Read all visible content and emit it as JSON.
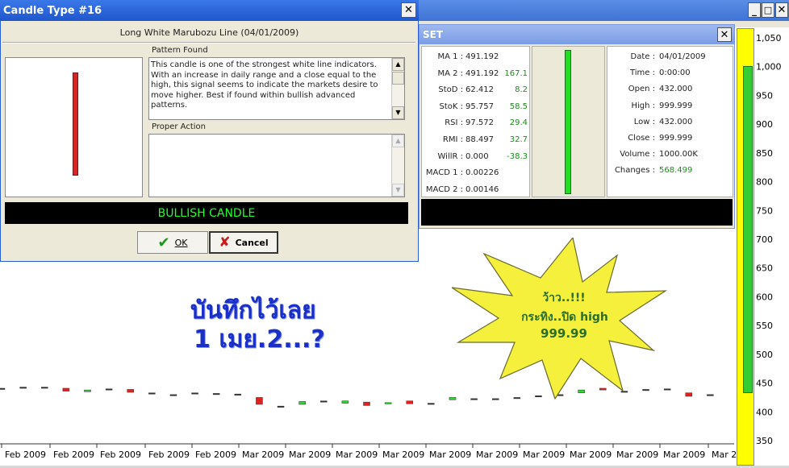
{
  "candle_dialog": {
    "title": "Candle Type #16",
    "subtitle": "Long White Marubozu Line (04/01/2009)",
    "pattern_found_label": "Pattern Found",
    "pattern_text": "This candle is one of the strongest white line indicators. With an increase in daily range and a close equal to the high, this signal seems to indicate the markets desire to move higher. Best if found within bullish advanced patterns.",
    "proper_action_label": "Proper Action",
    "proper_action_text": "",
    "signal": "BULLISH CANDLE",
    "ok_label": "OK",
    "cancel_label": "Cancel"
  },
  "set_panel": {
    "title": "SET",
    "indicators": [
      {
        "label": "MA 1 :",
        "value": "491.192",
        "extra": ""
      },
      {
        "label": "MA 2 :",
        "value": "491.192",
        "extra": "167.1"
      },
      {
        "label": "StoD :",
        "value": "62.412",
        "extra": "8.2"
      },
      {
        "label": "StoK :",
        "value": "95.757",
        "extra": "58.5"
      },
      {
        "label": "RSI :",
        "value": "97.572",
        "extra": "29.4"
      },
      {
        "label": "RMI :",
        "value": "88.497",
        "extra": "32.7"
      },
      {
        "label": "WillR :",
        "value": "0.000",
        "extra": "-38.3"
      },
      {
        "label": "MACD 1 :",
        "value": "0.00226",
        "extra": ""
      },
      {
        "label": "MACD 2 :",
        "value": "0.00146",
        "extra": ""
      }
    ],
    "quote": [
      {
        "label": "Date :",
        "value": "04/01/2009"
      },
      {
        "label": "Time :",
        "value": "0:00:00"
      },
      {
        "label": "Open :",
        "value": "432.000"
      },
      {
        "label": "High :",
        "value": "999.999"
      },
      {
        "label": "Low :",
        "value": "432.000"
      },
      {
        "label": "Close :",
        "value": "999.999"
      },
      {
        "label": "Volume :",
        "value": "1000.00K"
      },
      {
        "label": "Changes :",
        "value": "568.499"
      }
    ]
  },
  "annotations": {
    "blue_line1": "บันทึกไว้เลย",
    "blue_line2": "1 เมย.2...?",
    "star_line1": "ว้าว..!!!",
    "star_line2": "กระทิง..ปิด high",
    "star_line3": "999.99"
  },
  "colors": {
    "title_bar": "#2a5fd0",
    "bullish": "#22dd22",
    "bearish": "#dd2222",
    "signal_text": "#22ff22",
    "blue_text": "#1a2fc8",
    "star_fill": "#f4f03c"
  },
  "chart_data": {
    "type": "candlestick",
    "y_ticks": [
      "1,050",
      "1,000",
      "950",
      "900",
      "850",
      "800",
      "750",
      "700",
      "650",
      "600",
      "550",
      "500",
      "450",
      "400",
      "350"
    ],
    "ylim": [
      350,
      1050
    ],
    "x_labels": [
      "Feb 2009",
      "Feb 2009",
      "Feb 2009",
      "Feb 2009",
      "Feb 2009",
      "Mar 2009",
      "Mar 2009",
      "Mar 2009",
      "Mar 2009",
      "Mar 2009",
      "Mar 2009",
      "Mar 2009",
      "Mar 2009",
      "Mar 2009",
      "Mar 2009",
      "Mar 2009"
    ],
    "candles": [
      {
        "open": 441,
        "close": 441,
        "dir": "flat"
      },
      {
        "open": 443,
        "close": 443,
        "dir": "flat"
      },
      {
        "open": 443,
        "close": 443,
        "dir": "flat"
      },
      {
        "open": 441,
        "close": 436,
        "dir": "down"
      },
      {
        "open": 435,
        "close": 438,
        "dir": "up"
      },
      {
        "open": 440,
        "close": 440,
        "dir": "flat"
      },
      {
        "open": 439,
        "close": 434,
        "dir": "down"
      },
      {
        "open": 433,
        "close": 433,
        "dir": "flat"
      },
      {
        "open": 430,
        "close": 430,
        "dir": "flat"
      },
      {
        "open": 433,
        "close": 433,
        "dir": "flat"
      },
      {
        "open": 432,
        "close": 432,
        "dir": "flat"
      },
      {
        "open": 431,
        "close": 431,
        "dir": "flat"
      },
      {
        "open": 425,
        "close": 413,
        "dir": "down"
      },
      {
        "open": 410,
        "close": 410,
        "dir": "flat"
      },
      {
        "open": 413,
        "close": 418,
        "dir": "up"
      },
      {
        "open": 419,
        "close": 419,
        "dir": "flat"
      },
      {
        "open": 415,
        "close": 419,
        "dir": "up"
      },
      {
        "open": 417,
        "close": 411,
        "dir": "down"
      },
      {
        "open": 414,
        "close": 416,
        "dir": "up"
      },
      {
        "open": 419,
        "close": 414,
        "dir": "down"
      },
      {
        "open": 415,
        "close": 415,
        "dir": "flat"
      },
      {
        "open": 421,
        "close": 425,
        "dir": "up"
      },
      {
        "open": 423,
        "close": 423,
        "dir": "flat"
      },
      {
        "open": 423,
        "close": 423,
        "dir": "flat"
      },
      {
        "open": 425,
        "close": 425,
        "dir": "flat"
      },
      {
        "open": 428,
        "close": 428,
        "dir": "flat"
      },
      {
        "open": 430,
        "close": 430,
        "dir": "flat"
      },
      {
        "open": 433,
        "close": 438,
        "dir": "up"
      },
      {
        "open": 441,
        "close": 438,
        "dir": "down"
      },
      {
        "open": 436,
        "close": 436,
        "dir": "flat"
      },
      {
        "open": 439,
        "close": 439,
        "dir": "flat"
      },
      {
        "open": 440,
        "close": 440,
        "dir": "flat"
      },
      {
        "open": 433,
        "close": 427,
        "dir": "down"
      },
      {
        "open": 430,
        "close": 430,
        "dir": "flat"
      },
      {
        "open": 432,
        "close": 999.999,
        "dir": "up"
      }
    ]
  }
}
